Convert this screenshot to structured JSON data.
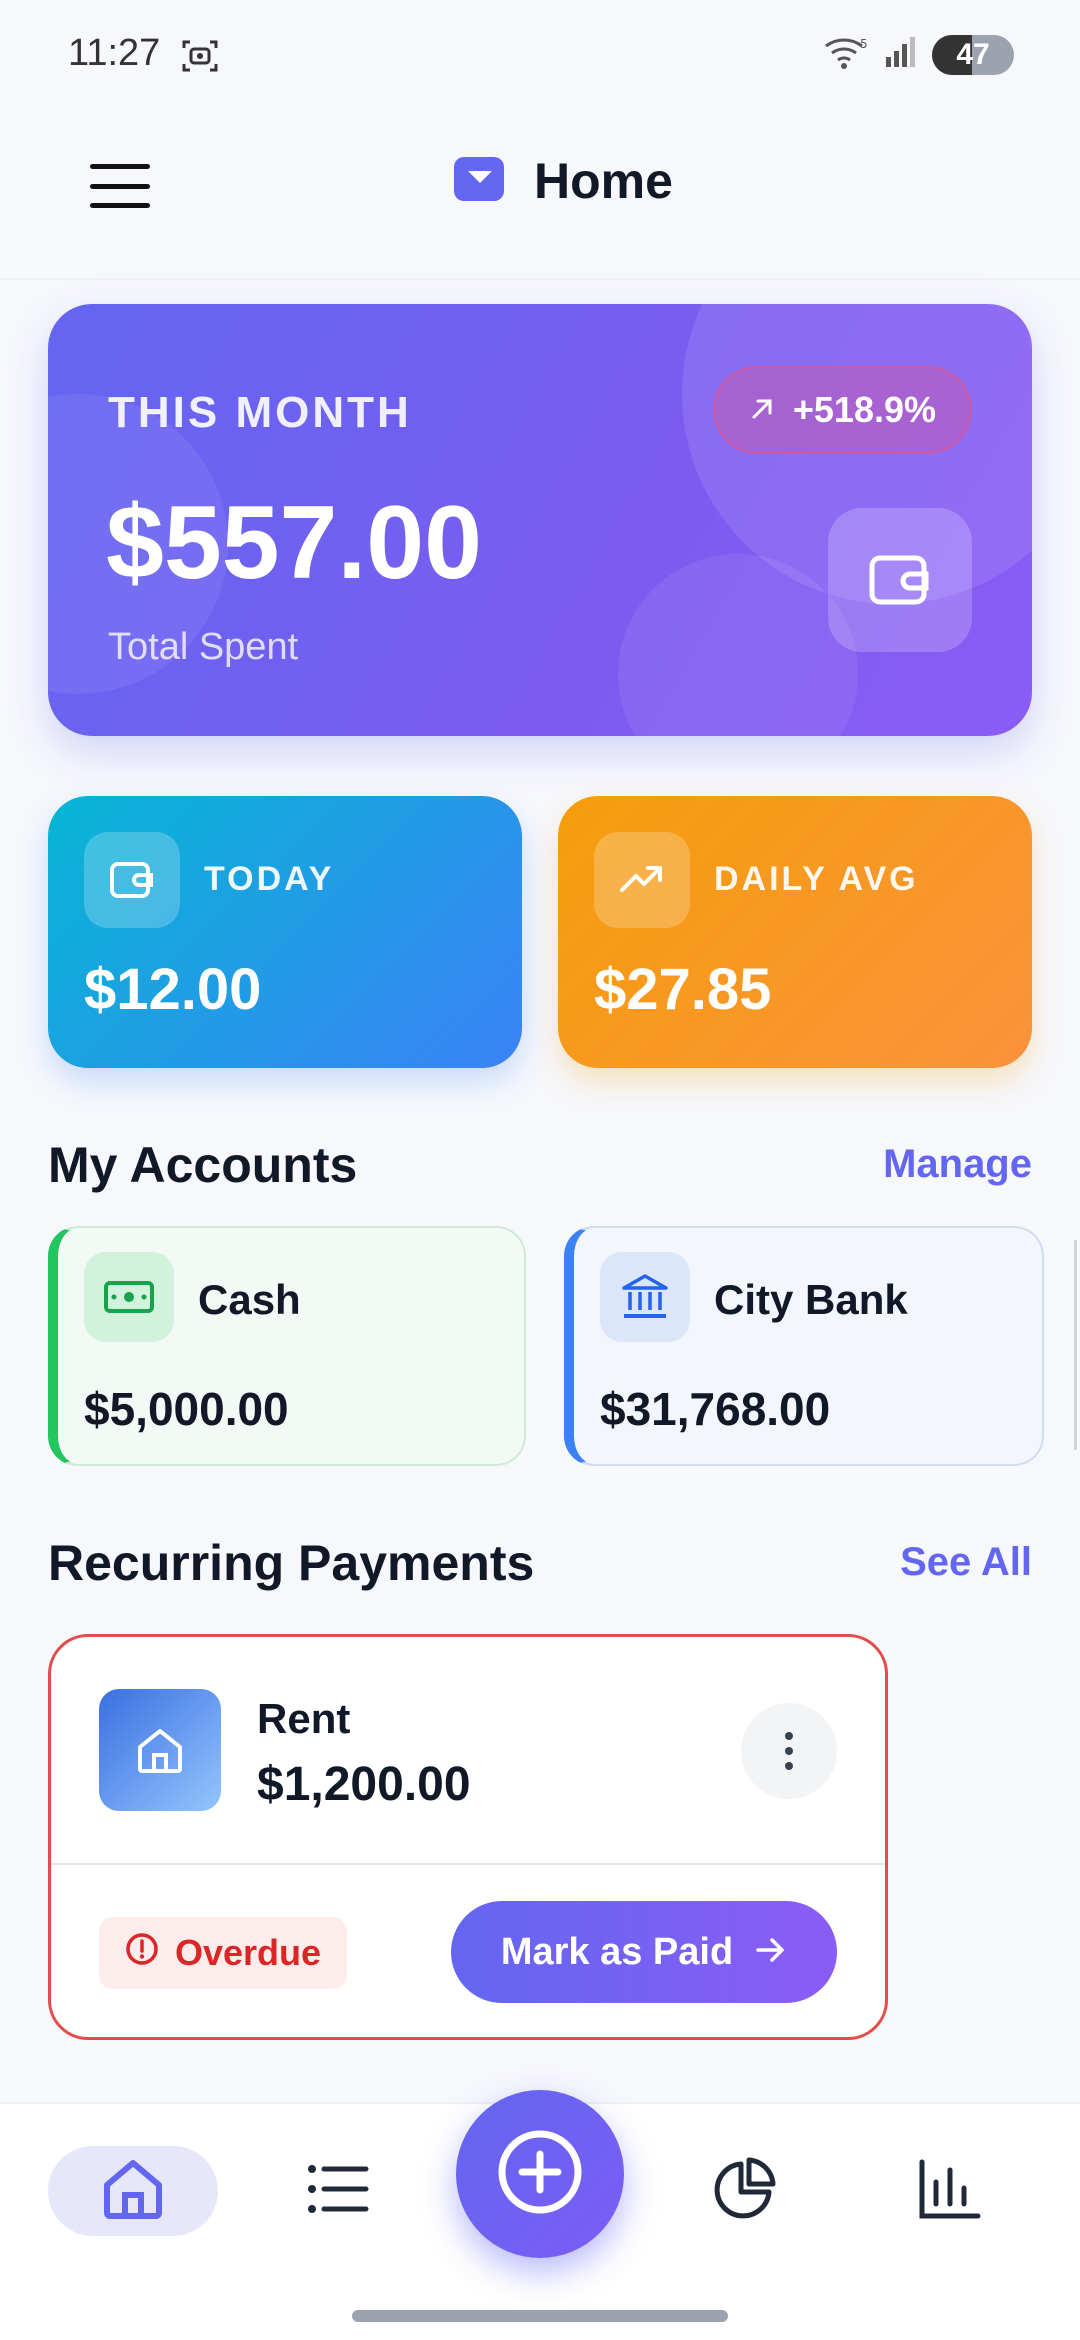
{
  "status_bar": {
    "time": "11:27",
    "battery": "47"
  },
  "app_bar": {
    "title": "Home"
  },
  "summary": {
    "label": "THIS MONTH",
    "amount": "$557.00",
    "subtitle": "Total Spent",
    "change": "+518.9%"
  },
  "stats": {
    "today_label": "TODAY",
    "today_value": "$12.00",
    "avg_label": "DAILY AVG",
    "avg_value": "$27.85"
  },
  "accounts": {
    "title": "My Accounts",
    "manage_label": "Manage",
    "items": [
      {
        "name": "Cash",
        "balance": "$5,000.00",
        "color": "#22c55e"
      },
      {
        "name": "City Bank",
        "balance": "$31,768.00",
        "color": "#3b82f6"
      }
    ]
  },
  "recurring": {
    "title": "Recurring Payments",
    "see_all_label": "See All",
    "items": [
      {
        "name": "Rent",
        "amount": "$1,200.00",
        "status": "Overdue",
        "action": "Mark as Paid"
      }
    ]
  },
  "bottom_nav": {
    "items": [
      "home-icon",
      "list-icon",
      "add-icon",
      "pie-chart-icon",
      "bar-chart-icon"
    ],
    "active": "home-icon"
  },
  "colors": {
    "accent": "#6366f1",
    "overdue": "#dc2626",
    "today_card": "#3b82f6",
    "avg_card": "#f59e0b"
  }
}
